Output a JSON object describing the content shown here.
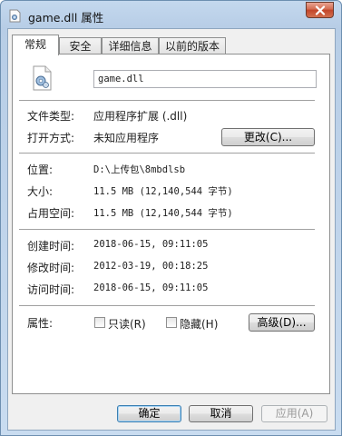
{
  "window": {
    "title": "game.dll 属性"
  },
  "tabs": [
    {
      "label": "常规"
    },
    {
      "label": "安全"
    },
    {
      "label": "详细信息"
    },
    {
      "label": "以前的版本"
    }
  ],
  "file": {
    "name": "game.dll",
    "type_label": "文件类型:",
    "type_value": "应用程序扩展 (.dll)",
    "open_with_label": "打开方式:",
    "open_with_value": "未知应用程序",
    "change_button": "更改(C)...",
    "location_label": "位置:",
    "location_value": "D:\\上传包\\8mbdlsb",
    "size_label": "大小:",
    "size_value": "11.5 MB (12,140,544 字节)",
    "disk_size_label": "占用空间:",
    "disk_size_value": "11.5 MB (12,140,544 字节)",
    "created_label": "创建时间:",
    "created_value": "2018-06-15, 09:11:05",
    "modified_label": "修改时间:",
    "modified_value": "2012-03-19, 00:18:25",
    "accessed_label": "访问时间:",
    "accessed_value": "2018-06-15, 09:11:05",
    "attributes_label": "属性:",
    "readonly_label": "只读(R)",
    "readonly_checked": false,
    "hidden_label": "隐藏(H)",
    "hidden_checked": false,
    "advanced_button": "高级(D)..."
  },
  "footer": {
    "ok": "确定",
    "cancel": "取消",
    "apply": "应用(A)"
  },
  "icons": {
    "file": "dll-file-gear-icon",
    "close": "close-icon"
  }
}
